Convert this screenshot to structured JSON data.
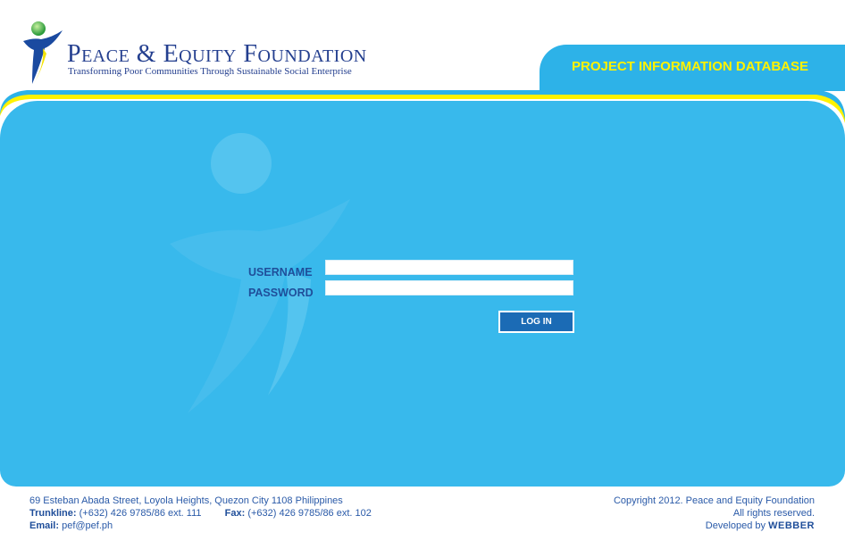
{
  "header": {
    "org_name": "Peace & Equity Foundation",
    "tagline": "Transforming Poor Communities Through Sustainable Social Enterprise",
    "db_title": "PROJECT INFORMATION DATABASE"
  },
  "login": {
    "username_label": "USERNAME",
    "password_label": "PASSWORD",
    "username_value": "",
    "password_value": "",
    "button_label": "LOG IN"
  },
  "footer": {
    "address": "69 Esteban Abada Street, Loyola Heights, Quezon City 1108 Philippines",
    "trunkline_label": "Trunkline:",
    "trunkline_value": "(+632) 426 9785/86 ext. 111",
    "fax_label": "Fax:",
    "fax_value": "(+632) 426 9785/86 ext. 102",
    "email_label": "Email:",
    "email_value": "pef@pef.ph",
    "copyright": "Copyright 2012. Peace and Equity Foundation",
    "rights": "All rights reserved.",
    "developed_by": "Developed by",
    "developer": "WEBBER"
  },
  "colors": {
    "panel": "#38b9ec",
    "tab": "#2db2e8",
    "tab_text": "#fff200",
    "brand_blue": "#243f8f",
    "button": "#1b6bb5"
  }
}
